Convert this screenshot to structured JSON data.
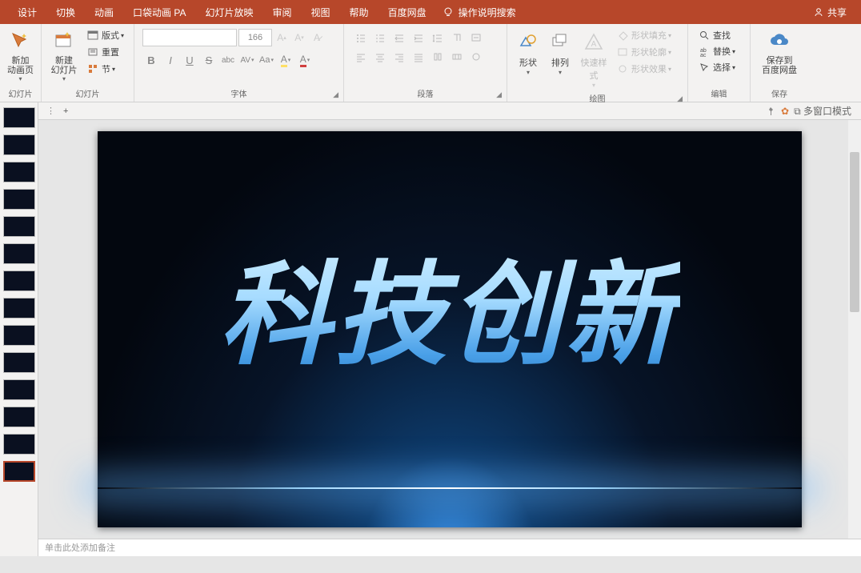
{
  "menu": {
    "items": [
      "设计",
      "切换",
      "动画",
      "口袋动画 PA",
      "幻灯片放映",
      "审阅",
      "视图",
      "帮助",
      "百度网盘"
    ],
    "tell_me": "操作说明搜索",
    "share": "共享"
  },
  "ribbon": {
    "clipboard": {
      "big": "新加\n动画页",
      "label": "幻灯片"
    },
    "slides": {
      "big": "新建\n幻灯片",
      "layout": "版式",
      "reset": "重置",
      "section": "节",
      "label": "幻灯片"
    },
    "font": {
      "name_placeholder": "",
      "size": "166",
      "label": "字体",
      "buttons": {
        "bold": "B",
        "italic": "I",
        "underline": "U",
        "strike": "S",
        "abc": "abc",
        "av": "AV",
        "aa": "Aa",
        "clear": "A",
        "highlight": "A",
        "color": "A"
      }
    },
    "paragraph": {
      "label": "段落"
    },
    "drawing": {
      "shapes": "形状",
      "arrange": "排列",
      "quick": "快速样式",
      "fill": "形状填充",
      "outline": "形状轮廓",
      "effects": "形状效果",
      "label": "绘图"
    },
    "editing": {
      "find": "查找",
      "replace": "替换",
      "select": "选择",
      "label": "编辑"
    },
    "save": {
      "big": "保存到\n百度网盘",
      "label": "保存"
    }
  },
  "tabstrip": {
    "multi_window": "多窗口模式"
  },
  "slide": {
    "title": "科技创新"
  },
  "notes": {
    "placeholder": "单击此处添加备注"
  }
}
